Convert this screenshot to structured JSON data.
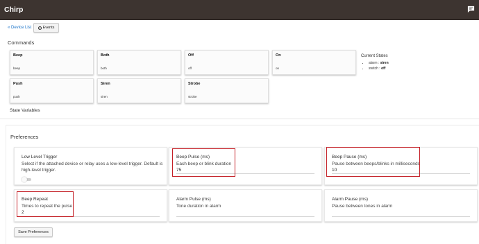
{
  "app": {
    "title": "Chirp",
    "message_icon": "chat-icon"
  },
  "nav": {
    "back_label": "« Device List",
    "events_label": "Events",
    "events_icon": "info-icon"
  },
  "commands": {
    "heading": "Commands",
    "items": [
      {
        "label": "Beep",
        "arg": "beep"
      },
      {
        "label": "Both",
        "arg": "both"
      },
      {
        "label": "Off",
        "arg": "off"
      },
      {
        "label": "On",
        "arg": "on"
      },
      {
        "label": "Push",
        "arg": "push"
      },
      {
        "label": "Siren",
        "arg": "siren"
      },
      {
        "label": "Strobe",
        "arg": "strobe"
      }
    ]
  },
  "current_states": {
    "heading": "Current States",
    "items": [
      {
        "name": "alarm",
        "value": "siren"
      },
      {
        "name": "switch",
        "value": "off"
      }
    ]
  },
  "state_variables": {
    "heading": "State Variables"
  },
  "preferences": {
    "heading": "Preferences",
    "items": [
      {
        "title": "Low Level Trigger",
        "description": "Select if the attached device or relay uses a low-level trigger. Default is high-level trigger.",
        "toggle_on": false
      },
      {
        "title": "Beep Pulse (ms)",
        "description": "Each beep or blink duration",
        "value": "75"
      },
      {
        "title": "Beep Pause (ms)",
        "description": "Pause between beeps/blinks in milliseconds",
        "value": "10"
      },
      {
        "title": "Beep Repeat",
        "description": "Times to repeat the pulse",
        "value": "2"
      },
      {
        "title": "Alarm Pulse (ms)",
        "description": "Tone duration in alarm",
        "value": ""
      },
      {
        "title": "Alarm Pause (ms)",
        "description": "Pause between tones in alarm",
        "value": ""
      }
    ],
    "save_label": "Save Preferences"
  },
  "colors": {
    "topbar": "#3d3430",
    "highlight": "#c42027",
    "link": "#1a73c9"
  }
}
